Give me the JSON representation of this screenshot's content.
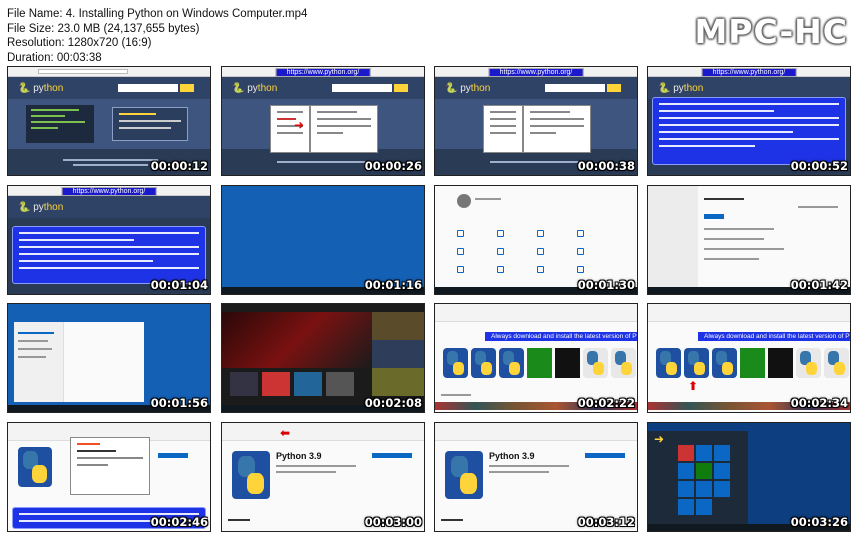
{
  "file_info": {
    "name_line": "File Name: 4. Installing Python on Windows Computer.mp4",
    "size_line": "File Size: 23.0 MB (24,137,655 bytes)",
    "resolution_line": "Resolution: 1280x720 (16:9)",
    "duration_line": "Duration: 00:03:38"
  },
  "brand": "MPC-HC",
  "url_label": "https://www.python.org/",
  "banner_text": "Always download and install the latest version of Python",
  "app_name": "Python 3.9",
  "colors": {
    "accent_blue": "#1f33e6",
    "desktop_blue": "#1460b5",
    "python_blue": "#3776ab",
    "python_yellow": "#ffd43b"
  },
  "thumbnails": [
    {
      "time": "00:00:12",
      "scene": "python-homepage"
    },
    {
      "time": "00:00:26",
      "scene": "python-download-popup"
    },
    {
      "time": "00:00:38",
      "scene": "python-download-popup"
    },
    {
      "time": "00:00:52",
      "scene": "python-store-note"
    },
    {
      "time": "00:01:04",
      "scene": "python-store-note"
    },
    {
      "time": "00:01:16",
      "scene": "blue-desktop"
    },
    {
      "time": "00:01:30",
      "scene": "windows-settings"
    },
    {
      "time": "00:01:42",
      "scene": "windows-update"
    },
    {
      "time": "00:01:56",
      "scene": "file-explorer"
    },
    {
      "time": "00:02:08",
      "scene": "store-home"
    },
    {
      "time": "00:02:22",
      "scene": "store-python-search"
    },
    {
      "time": "00:02:34",
      "scene": "store-python-search"
    },
    {
      "time": "00:02:46",
      "scene": "store-signin"
    },
    {
      "time": "00:03:00",
      "scene": "store-python-page"
    },
    {
      "time": "00:03:12",
      "scene": "store-python-page"
    },
    {
      "time": "00:03:26",
      "scene": "start-menu"
    }
  ]
}
